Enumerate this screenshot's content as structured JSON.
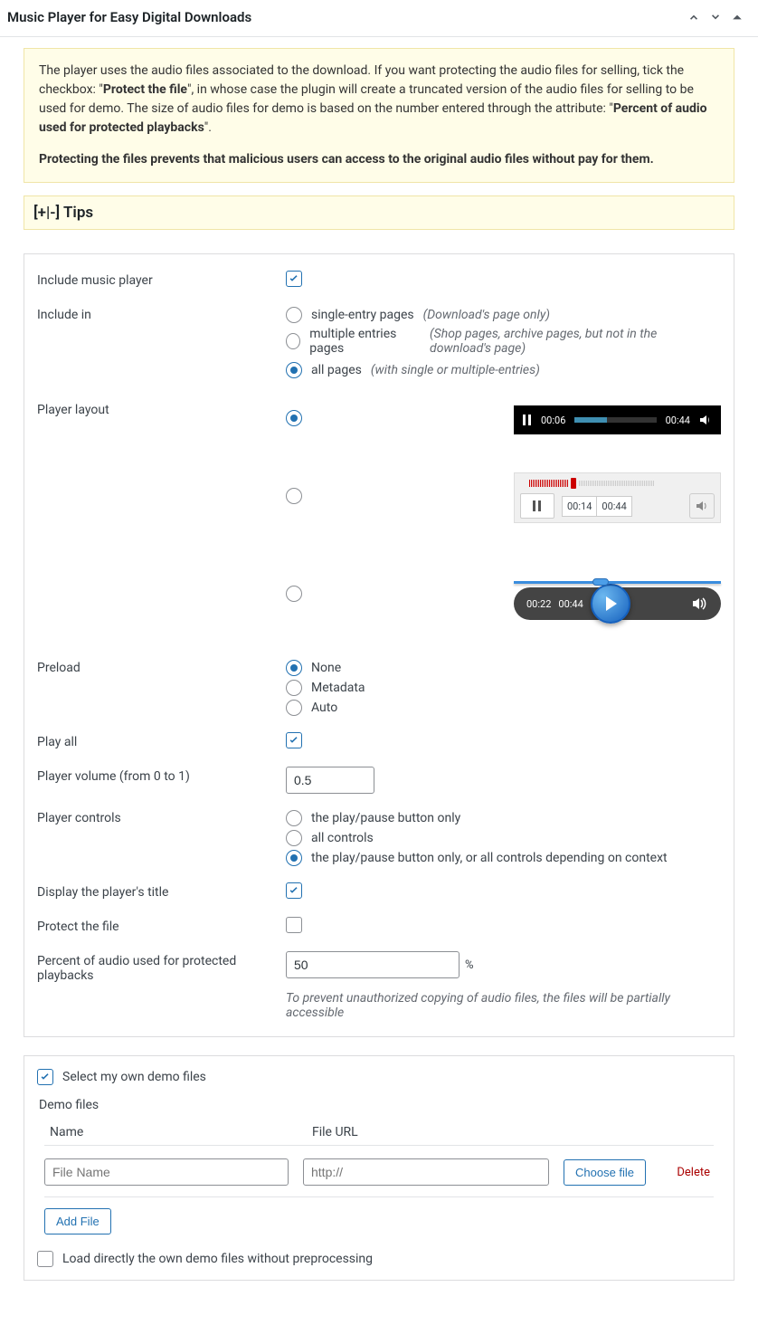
{
  "header": {
    "title": "Music Player for Easy Digital Downloads"
  },
  "notice": {
    "text1_a": "The player uses the audio files associated to the download. If you want protecting the audio files for selling, tick the checkbox: \"",
    "text1_b": "Protect the file",
    "text1_c": "\", in whose case the plugin will create a truncated version of the audio files for selling to be used for demo. The size of audio files for demo is based on the number entered through the attribute: \"",
    "text1_d": "Percent of audio used for protected playbacks",
    "text1_e": "\".",
    "text2": "Protecting the files prevents that malicious users can access to the original audio files without pay for them."
  },
  "tips": {
    "toggle": "[+|-]",
    "label": "Tips"
  },
  "fields": {
    "include_player": {
      "label": "Include music player",
      "checked": true
    },
    "include_in": {
      "label": "Include in",
      "opt1": {
        "label": "single-entry pages",
        "hint": "(Download's page only)"
      },
      "opt2": {
        "label": "multiple entries pages",
        "hint": "(Shop pages, archive pages, but not in the download's page)"
      },
      "opt3": {
        "label": "all pages",
        "hint": "(with single or multiple-entries)",
        "selected": true
      }
    },
    "player_layout": {
      "label": "Player layout",
      "skin1": {
        "cur": "00:06",
        "total": "00:44"
      },
      "skin2": {
        "cur": "00:14",
        "total": "00:44"
      },
      "skin3": {
        "cur": "00:22",
        "total": "00:44"
      }
    },
    "preload": {
      "label": "Preload",
      "opt1": "None",
      "opt2": "Metadata",
      "opt3": "Auto"
    },
    "play_all": {
      "label": "Play all",
      "checked": true
    },
    "volume": {
      "label": "Player volume (from 0 to 1)",
      "value": "0.5"
    },
    "controls": {
      "label": "Player controls",
      "opt1": "the play/pause button only",
      "opt2": "all controls",
      "opt3": "the play/pause button only, or all controls depending on context"
    },
    "display_title": {
      "label": "Display the player's title",
      "checked": true
    },
    "protect": {
      "label": "Protect the file",
      "checked": false
    },
    "percent": {
      "label": "Percent of audio used for protected playbacks",
      "value": "50",
      "unit": "%",
      "desc": "To prevent unauthorized copying of audio files, the files will be partially accessible"
    }
  },
  "demo": {
    "own_demo": {
      "label": "Select my own demo files",
      "checked": true
    },
    "files_label": "Demo files",
    "head_name": "Name",
    "head_url": "File URL",
    "name_ph": "File Name",
    "url_ph": "http://",
    "choose": "Choose file",
    "delete": "Delete",
    "add": "Add File",
    "load_direct": {
      "label": "Load directly the own demo files without preprocessing",
      "checked": false
    }
  }
}
